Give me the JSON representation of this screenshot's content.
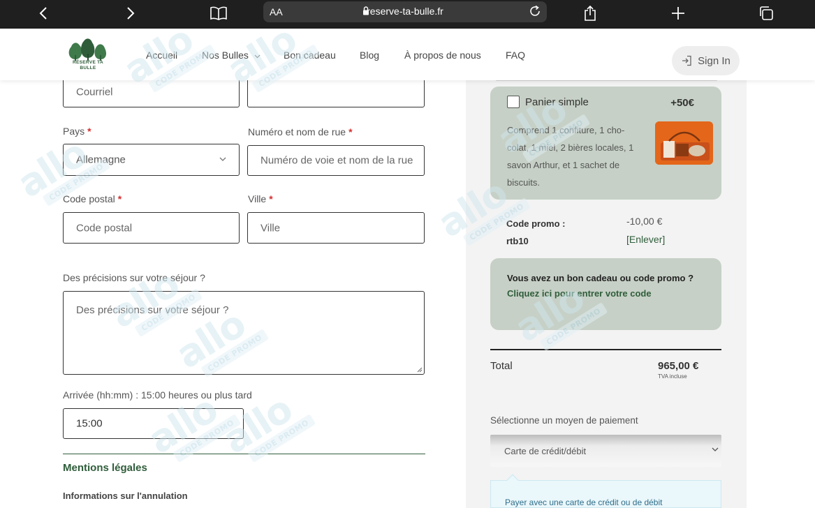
{
  "browser": {
    "url": "reserve-ta-bulle.fr",
    "text_size_label": "AA"
  },
  "header": {
    "logo_text": "RÉSERVE TA BULLE",
    "nav": [
      "Accueil",
      "Nos Bulles",
      "Bon cadeau",
      "Blog",
      "À propos de nous",
      "FAQ"
    ],
    "signin_label": "Sign In"
  },
  "form": {
    "email_placeholder": "Courriel",
    "country_label": "Pays",
    "country_value": "Allemagne",
    "street_label": "Numéro et nom de rue",
    "street_placeholder": "Numéro de voie et nom de la rue",
    "postal_label": "Code postal",
    "postal_placeholder": "Code postal",
    "city_label": "Ville",
    "city_placeholder": "Ville",
    "notes_label": "Des précisions sur votre séjour ?",
    "notes_placeholder": "Des précisions sur votre séjour ?",
    "arrival_label": "Arrivée (hh:mm) : 15:00 heures ou plus tard",
    "arrival_value": "15:00",
    "required_mark": "*"
  },
  "legal": {
    "title": "Mentions légales",
    "cancellation_title": "Informations sur l'annulation"
  },
  "order": {
    "basket_title": "Panier simple",
    "basket_price": "+50€",
    "basket_checked": false,
    "basket_description": "Comprend 1 confiture, 1 cho-colat, 1 miel, 2 bières locales, 1 savon Arthur, et 1 sachet de biscuits.",
    "promo_label_line1": "Code promo :",
    "promo_code": "rtb10",
    "promo_amount": "-10,00 €",
    "promo_remove": "[Enlever]",
    "gift_text": "Vous avez un bon cadeau ou code promo ?",
    "gift_link": "Cliquez ici pour entrer votre code",
    "total_label": "Total",
    "total_value": "965,00 €",
    "tva_note": "TVA incluse",
    "payment_label": "Sélectionne un moyen de paiement",
    "payment_value": "Carte de crédit/débit",
    "payment_info": "Payer avec une carte de crédit ou de débit"
  },
  "watermark": {
    "big": "allo",
    "small": "CODE PROMO"
  },
  "colors": {
    "brand_green": "#2f5d3a",
    "card_bg": "#c6d0c6",
    "required_red": "#d32f2f"
  }
}
